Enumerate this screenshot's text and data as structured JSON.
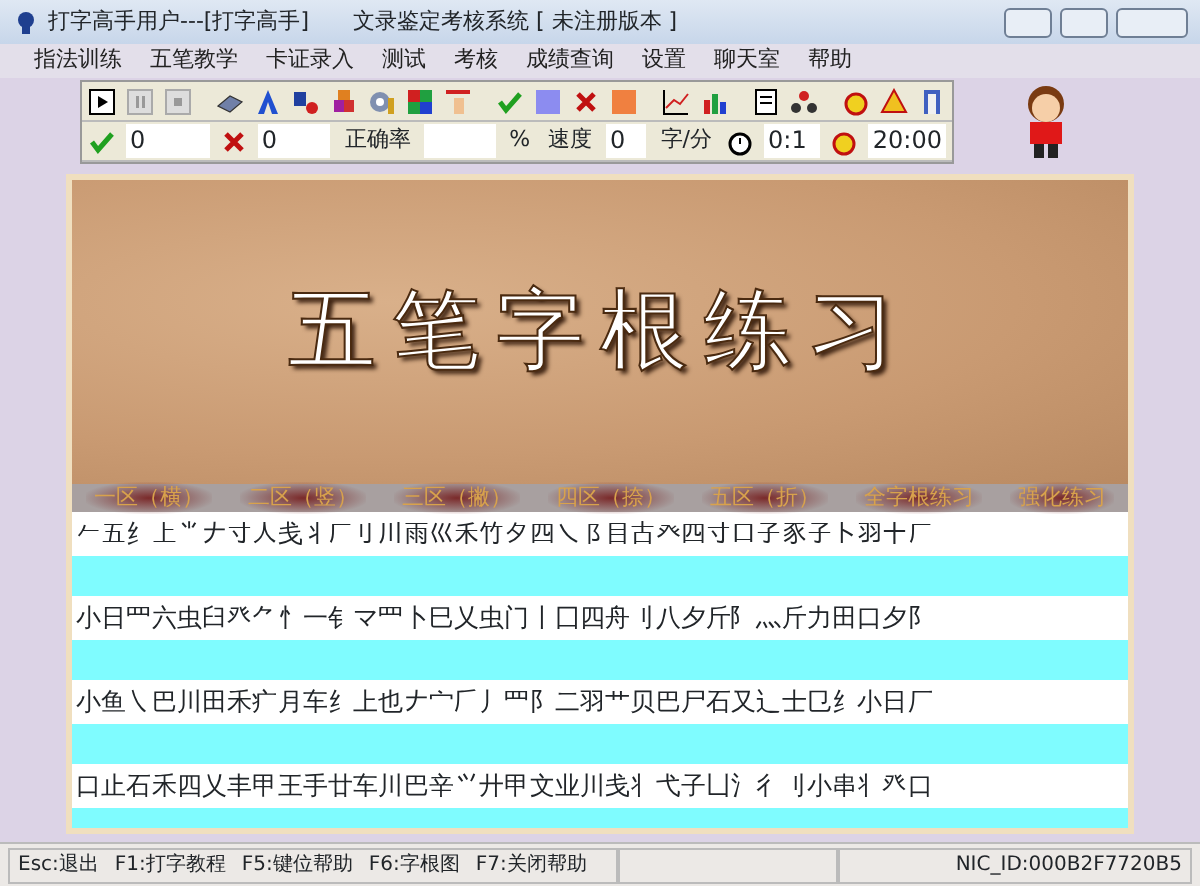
{
  "window": {
    "title": "打字高手用户---[打字高手]　　文录鉴定考核系统 [ 未注册版本 ]"
  },
  "menu": [
    "指法训练",
    "五笔教学",
    "卡证录入",
    "测试",
    "考核",
    "成绩查询",
    "设置",
    "聊天室",
    "帮助"
  ],
  "stats": {
    "correct": "0",
    "wrong": "0",
    "accuracy_label": "正确率",
    "accuracy_unit": "%",
    "speed_label": "速度",
    "speed": "0",
    "speed_unit": "字/分",
    "elapsed": "0:1",
    "limit": "20:00"
  },
  "banner": {
    "title": "五笔字根练习"
  },
  "tabs": [
    {
      "label": "一区（横）",
      "selected": false
    },
    {
      "label": "二区（竖）",
      "selected": false
    },
    {
      "label": "三区（撇）",
      "selected": false
    },
    {
      "label": "四区（捺）",
      "selected": false
    },
    {
      "label": "五区（折）",
      "selected": false
    },
    {
      "label": "全字根练习",
      "selected": false
    },
    {
      "label": "强化练习",
      "selected": false
    }
  ],
  "lines": [
    "𠂉五纟上⺌𠂇寸人戋丬厂刂川雨巛禾竹夕四乀阝目古癶四寸口子豕子卜羽十厂",
    "小日罒六虫臼癶⺈忄一钅マ罒卜巳乂虫门丨囗四舟刂八夕斤⻖灬斤力田口夕阝",
    "小鱼㇏巴川田禾疒月车纟上也𠂇宀𠂆丿罒阝二羽艹贝巴尸石又辶士㔾纟小日厂",
    "口止石禾四乂丰甲王手廿车川巴辛⺍廾甲文业川戋丬弋子凵氵彳刂小串丬癶口"
  ],
  "status_bar": [
    "Esc:退出",
    "F1:打字教程",
    "F5:键位帮助",
    "F6:字根图",
    "F7:关闭帮助"
  ],
  "status_right": "NIC_ID:000B2F7720B5"
}
